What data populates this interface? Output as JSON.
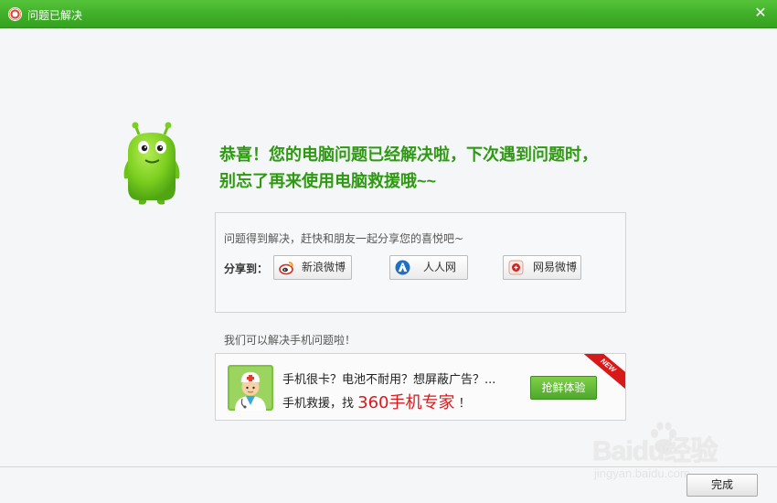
{
  "window": {
    "title": "问题已解决",
    "close_glyph": "✕"
  },
  "main": {
    "headline_line1": "恭喜！您的电脑问题已经解决啦，下次遇到问题时，",
    "headline_line2": "别忘了再来使用电脑救援哦~~"
  },
  "share": {
    "intro": "问题得到解决，赶快和朋友一起分享您的喜悦吧~",
    "label": "分享到：",
    "buttons": [
      {
        "label": "新浪微博",
        "icon": "sina-weibo-icon"
      },
      {
        "label": "人人网",
        "icon": "renren-icon"
      },
      {
        "label": "网易微博",
        "icon": "netease-weibo-icon"
      }
    ]
  },
  "mobile": {
    "note": "我们可以解决手机问题啦！",
    "promo_line1": "手机很卡？电池不耐用？想屏蔽广告？...",
    "promo_line2_prefix": "手机救援，找",
    "promo_brand": "360手机专家",
    "promo_line2_suffix": "！",
    "try_button": "抢鲜体验",
    "ribbon": "NEW"
  },
  "footer": {
    "done_button": "完成"
  },
  "watermark": {
    "brand": "Baidu经验",
    "url": "jingyan.baidu.com"
  },
  "colors": {
    "titlebar": "#3fae28",
    "headline": "#2e9a12",
    "brand_red": "#d9191c"
  }
}
